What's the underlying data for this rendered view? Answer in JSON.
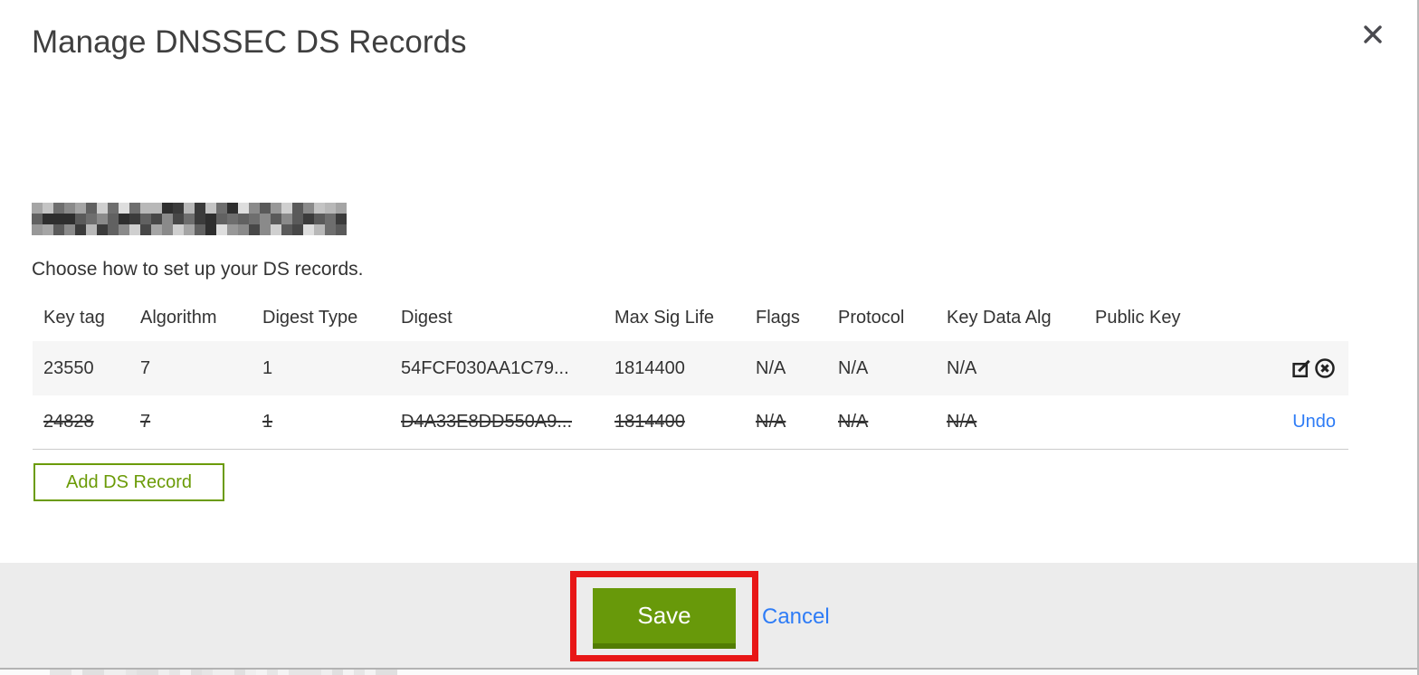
{
  "modal": {
    "title": "Manage DNSSEC DS Records",
    "intro": "Choose how to set up your DS records.",
    "domain": "(redacted / pixelated)"
  },
  "table": {
    "columns": [
      "Key tag",
      "Algorithm",
      "Digest Type",
      "Digest",
      "Max Sig Life",
      "Flags",
      "Protocol",
      "Key Data Alg",
      "Public Key"
    ],
    "rows": [
      {
        "key_tag": "23550",
        "algorithm": "7",
        "digest_type": "1",
        "digest": "54FCF030AA1C79...",
        "max_sig_life": "1814400",
        "flags": "N/A",
        "protocol": "N/A",
        "key_data_alg": "N/A",
        "public_key": "",
        "state": "active",
        "actions": [
          "edit",
          "delete"
        ]
      },
      {
        "key_tag": "24828",
        "algorithm": "7",
        "digest_type": "1",
        "digest": "D4A33E8DD550A9...",
        "max_sig_life": "1814400",
        "flags": "N/A",
        "protocol": "N/A",
        "key_data_alg": "N/A",
        "public_key": "",
        "state": "deleted",
        "undo_label": "Undo"
      }
    ]
  },
  "buttons": {
    "add_ds_record": "Add DS Record",
    "save": "Save",
    "cancel": "Cancel"
  },
  "icons": {
    "close": "close-icon",
    "edit": "edit-record-icon",
    "delete": "delete-record-icon"
  },
  "colors": {
    "green": "#68990a",
    "green_dark": "#527c04",
    "green_outline": "#6b9b07",
    "link_blue": "#2e7cf6",
    "annotation_red": "#e81717",
    "footer_bg": "#ececec",
    "row_highlight_bg": "#f6f6f6"
  }
}
